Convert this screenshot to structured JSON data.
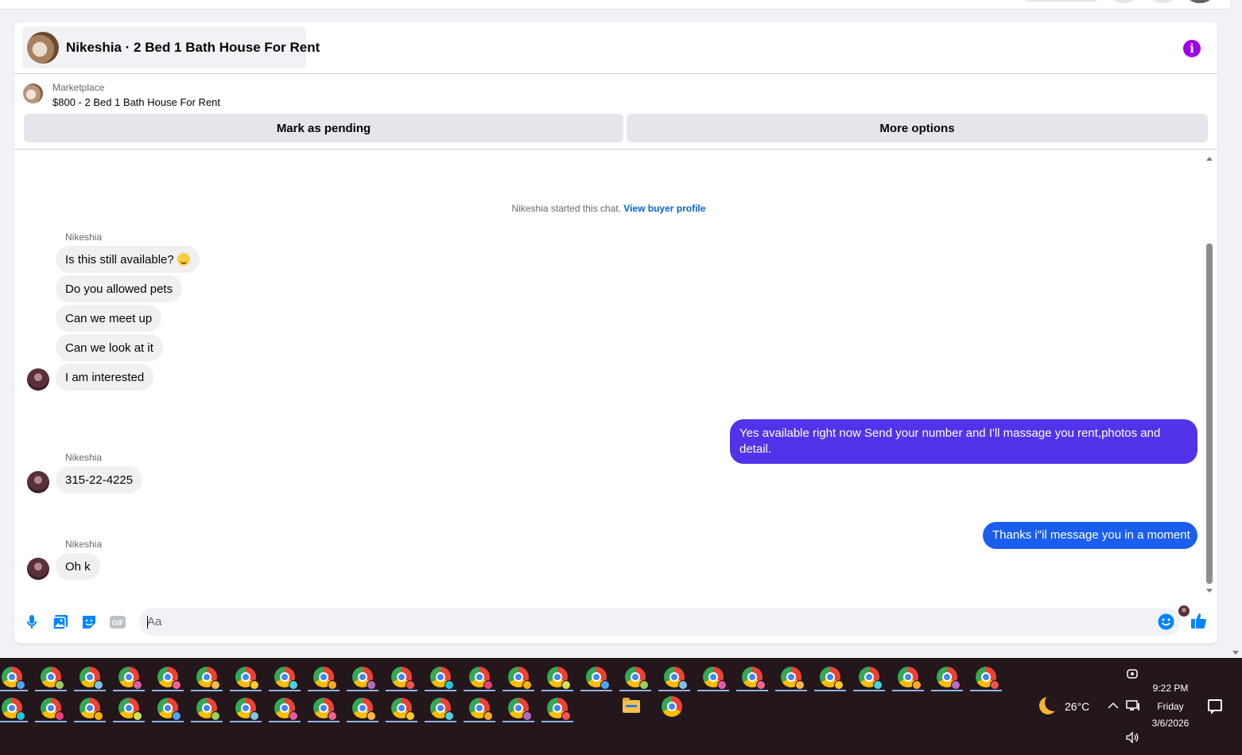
{
  "header": {
    "title": "Nikeshia · 2 Bed 1 Bath House For Rent",
    "info_icon": "info-icon"
  },
  "listing": {
    "label": "Marketplace",
    "price_title": "$800 - 2 Bed 1 Bath House For Rent",
    "mark_pending": "Mark as pending",
    "more_options": "More options"
  },
  "conversation": {
    "system_text": "Nikeshia started this chat.",
    "system_link": "View buyer profile",
    "sender_name": "Nikeshia",
    "group1": [
      "Is this still available?",
      "Do you allowed pets",
      "Can we meet up",
      "Can we look at it",
      "I am interested"
    ],
    "outgoing1": "Yes available right now Send your number and I'll massage you rent,photos and detail.",
    "group2": [
      "315-22-4225"
    ],
    "outgoing2": "Thanks i\"il message you in a moment",
    "group3": [
      "Oh k"
    ],
    "colors": {
      "outgoing1": "#5233ea",
      "outgoing2": "#1a5ef0",
      "incoming": "#f0f0f0",
      "accent": "#0084ff"
    }
  },
  "composer": {
    "placeholder": "Aa",
    "icons": [
      "microphone-icon",
      "photo-icon",
      "sticker-icon",
      "gif-icon",
      "emoji-icon",
      "like-icon"
    ],
    "gif_label": "GIF"
  },
  "taskbar": {
    "temperature": "26°C",
    "time": "9:22 PM",
    "day": "Friday",
    "date": "3/6/2026"
  }
}
